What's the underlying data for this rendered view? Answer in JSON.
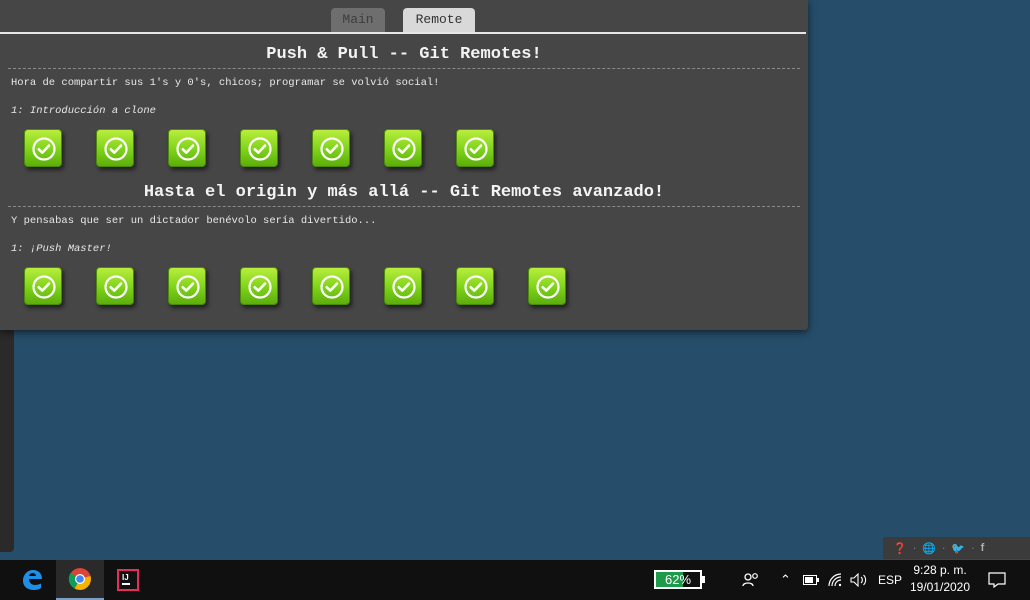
{
  "tabs": [
    {
      "label": "Main"
    },
    {
      "label": "Remote"
    }
  ],
  "sections": [
    {
      "title": "Push & Pull -- Git Remotes!",
      "description": "Hora de compartir sus 1's y 0's, chicos; programar se volvió social!",
      "level_label": "1: Introducción a clone",
      "badges_completed": 7
    },
    {
      "title": "Hasta el origin y más allá -- Git Remotes avanzado!",
      "description": "Y pensabas que ser un dictador benévolo sería divertido...",
      "level_label": "1: ¡Push Master!",
      "badges_completed": 8
    }
  ],
  "taskbar": {
    "battery": "62%",
    "battery_level": 0.62,
    "language": "ESP",
    "time": "9:28 p. m.",
    "date": "19/01/2020",
    "apps": [
      "edge-icon",
      "chrome-icon",
      "intellij-icon"
    ]
  },
  "colors": {
    "desktop": "#264d69",
    "panel": "#464646",
    "badge": "#7ed21a"
  }
}
